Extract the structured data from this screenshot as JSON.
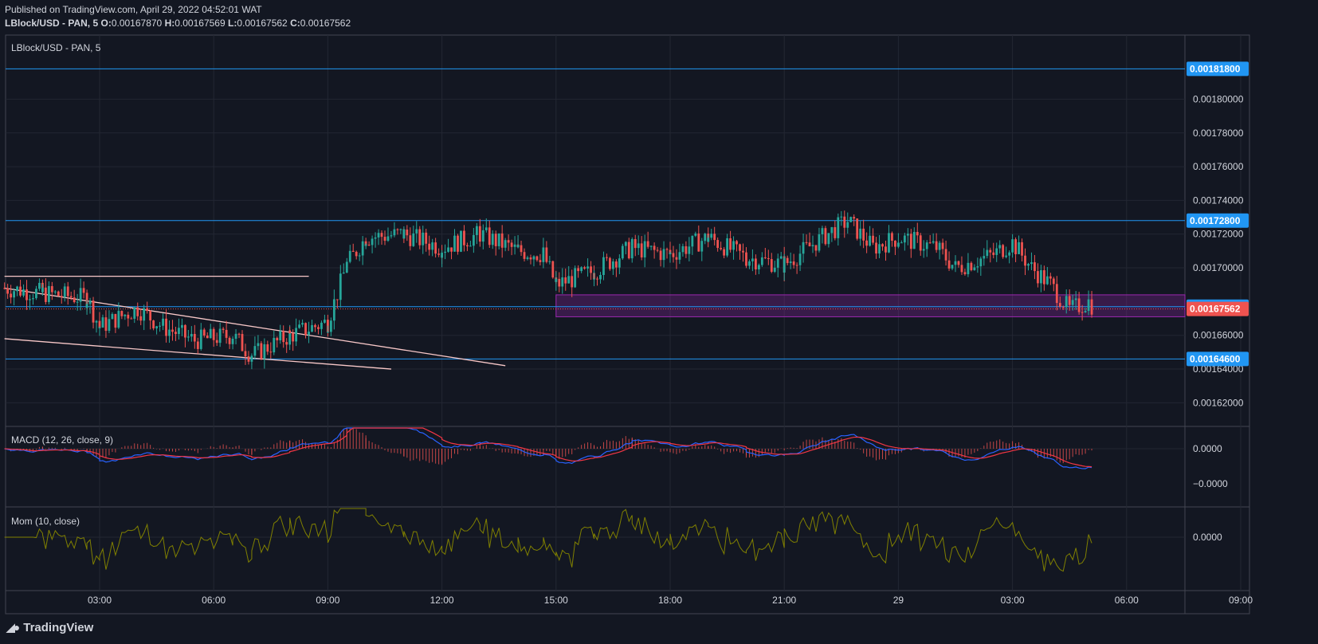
{
  "header": {
    "published": "Published on TradingView.com, April 29, 2022 04:52:01 WAT",
    "symbol": "LBlock/USD - PAN, 5",
    "o_label": "O:",
    "o_value": "0.00167870",
    "h_label": "H:",
    "h_value": "0.00167569",
    "l_label": "L:",
    "l_value": "0.00167562",
    "c_label": "C:",
    "c_value": "0.00167562"
  },
  "branding": {
    "name": "TradingView",
    "icon": "tradingview-logo-icon"
  },
  "colors": {
    "background": "#131722",
    "grid": "#232733",
    "up": "#26a69a",
    "down": "#ef5350",
    "level_line": "#2196f3",
    "price_tag": "#ef5350",
    "zone": "#9c27b0",
    "macd": "#2962ff",
    "signal": "#f23645",
    "momentum": "#808000",
    "trendline": "#f8c8c8"
  },
  "chart_data": {
    "type": "candlestick",
    "title": "LBlock/USD - PAN, 5",
    "timeframe_minutes": 5,
    "x_ticks": [
      "03:00",
      "06:00",
      "09:00",
      "12:00",
      "15:00",
      "18:00",
      "21:00",
      "29",
      "03:00",
      "06:00",
      "09:00"
    ],
    "y_ticks": [
      "0.00180000",
      "0.00178000",
      "0.00176000",
      "0.00174000",
      "0.00172000",
      "0.00170000",
      "0.00166000",
      "0.00164000",
      "0.00162000"
    ],
    "ylim": [
      0.001606,
      0.001838
    ],
    "current_price": "0.00167562",
    "levels": [
      {
        "label": "0.00181800",
        "value": 0.001818
      },
      {
        "label": "0.00172800",
        "value": 0.001728
      },
      {
        "label": "0.00167700",
        "value": 0.001677
      },
      {
        "label": "0.00164600",
        "value": 0.001646
      }
    ],
    "zone": {
      "from_time": "15:00",
      "price_top": 0.001684,
      "price_bottom": 0.001671
    },
    "trendlines": [
      {
        "from": [
          "00:30",
          0.001695
        ],
        "to": [
          "08:30",
          0.001695
        ]
      },
      {
        "from": [
          "00:30",
          0.001688
        ],
        "to": [
          "13:40",
          0.001642
        ]
      },
      {
        "from": [
          "00:30",
          0.001658
        ],
        "to": [
          "10:40",
          0.00164
        ]
      }
    ],
    "price_path": [
      [
        "00:30",
        0.001688
      ],
      [
        "01:30",
        0.001685
      ],
      [
        "02:40",
        0.001682
      ],
      [
        "03:00",
        0.001665
      ],
      [
        "04:00",
        0.001676
      ],
      [
        "04:40",
        0.001665
      ],
      [
        "05:30",
        0.001657
      ],
      [
        "06:30",
        0.00166
      ],
      [
        "07:00",
        0.001648
      ],
      [
        "08:00",
        0.00166
      ],
      [
        "09:00",
        0.001668
      ],
      [
        "09:30",
        0.001702
      ],
      [
        "10:00",
        0.001718
      ],
      [
        "11:00",
        0.00172
      ],
      [
        "12:00",
        0.001712
      ],
      [
        "13:00",
        0.00172
      ],
      [
        "14:00",
        0.00171
      ],
      [
        "14:40",
        0.001708
      ],
      [
        "15:00",
        0.00169
      ],
      [
        "16:00",
        0.001698
      ],
      [
        "17:00",
        0.001712
      ],
      [
        "18:00",
        0.001708
      ],
      [
        "19:00",
        0.001718
      ],
      [
        "20:00",
        0.001706
      ],
      [
        "21:00",
        0.001702
      ],
      [
        "22:00",
        0.001718
      ],
      [
        "22:40",
        0.001728
      ],
      [
        "23:20",
        0.001712
      ],
      [
        "00:00",
        0.001718
      ],
      [
        "01:00",
        0.001712
      ],
      [
        "01:30",
        0.0017
      ],
      [
        "02:30",
        0.001708
      ],
      [
        "03:00",
        0.001715
      ],
      [
        "03:30",
        0.0017
      ],
      [
        "04:00",
        0.00169
      ],
      [
        "04:30",
        0.001675
      ],
      [
        "05:00",
        0.00168
      ],
      [
        "05:10",
        0.001676
      ]
    ],
    "indicators": [
      {
        "name": "MACD (12, 26, close, 9)",
        "zero_label": "0.0000",
        "low_label": "−0.0000",
        "series": [
          {
            "name": "MACD",
            "color": "#2962ff"
          },
          {
            "name": "Signal",
            "color": "#f23645"
          },
          {
            "name": "Histogram",
            "color": "#ef5350"
          }
        ]
      },
      {
        "name": "Mom (10, close)",
        "zero_label": "0.0000",
        "series": [
          {
            "name": "Momentum",
            "color": "#808000"
          }
        ]
      }
    ]
  }
}
